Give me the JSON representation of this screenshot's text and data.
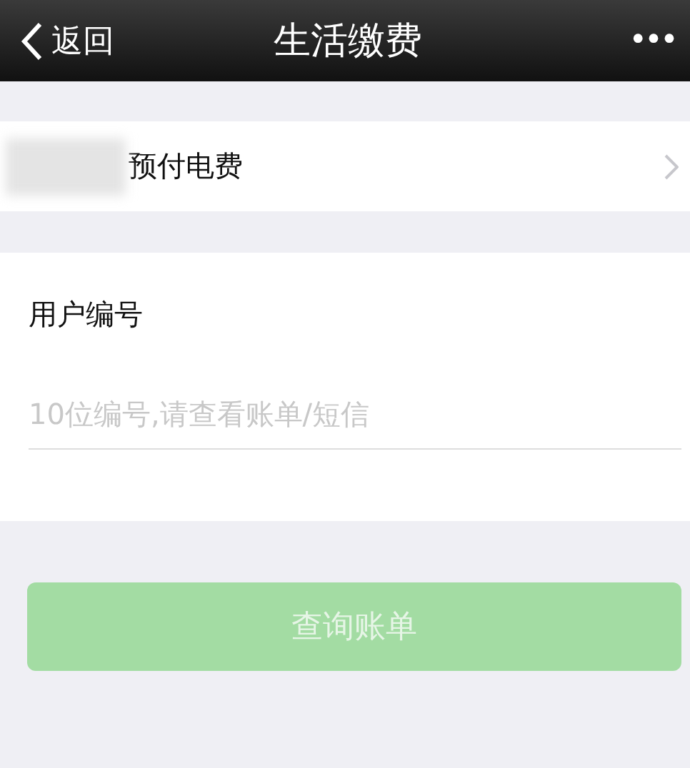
{
  "nav_bar": {
    "back_label": "返回",
    "title": "生活缴费",
    "more": "•••"
  },
  "biller_row": {
    "label": "预付电费"
  },
  "form": {
    "field_label": "用户编号",
    "placeholder": "10位编号,请查看账单/短信"
  },
  "submit_button": {
    "label": "查询账单",
    "disabled": true
  }
}
